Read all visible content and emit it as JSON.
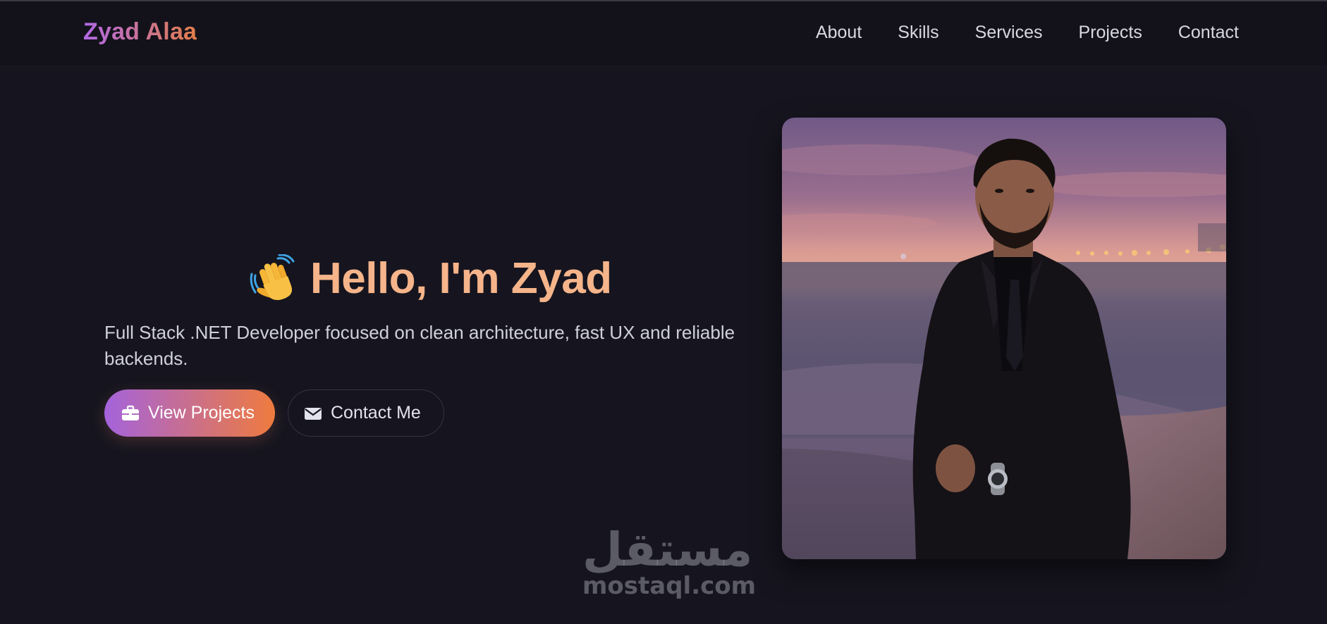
{
  "brand": {
    "name": "Zyad Alaa"
  },
  "nav": {
    "items": [
      {
        "label": "About"
      },
      {
        "label": "Skills"
      },
      {
        "label": "Services"
      },
      {
        "label": "Projects"
      },
      {
        "label": "Contact"
      }
    ]
  },
  "hero": {
    "heading": "Hello, I'm Zyad",
    "subtitle": "Full Stack .NET Developer focused on clean architecture, fast UX and reliable backends.",
    "primary_button": {
      "label": "View Projects",
      "icon": "briefcase-icon"
    },
    "secondary_button": {
      "label": "Contact Me",
      "icon": "envelope-icon"
    },
    "greeting_icon": "waving-hand-icon"
  },
  "photo": {
    "alt": "portrait-photo"
  },
  "watermark": {
    "arabic": "مستقل",
    "latin": "mostaql.com"
  },
  "colors": {
    "background": "#16151f",
    "accent_start": "#a463dc",
    "accent_end": "#ef7b3e",
    "heading": "#f5b48a"
  }
}
